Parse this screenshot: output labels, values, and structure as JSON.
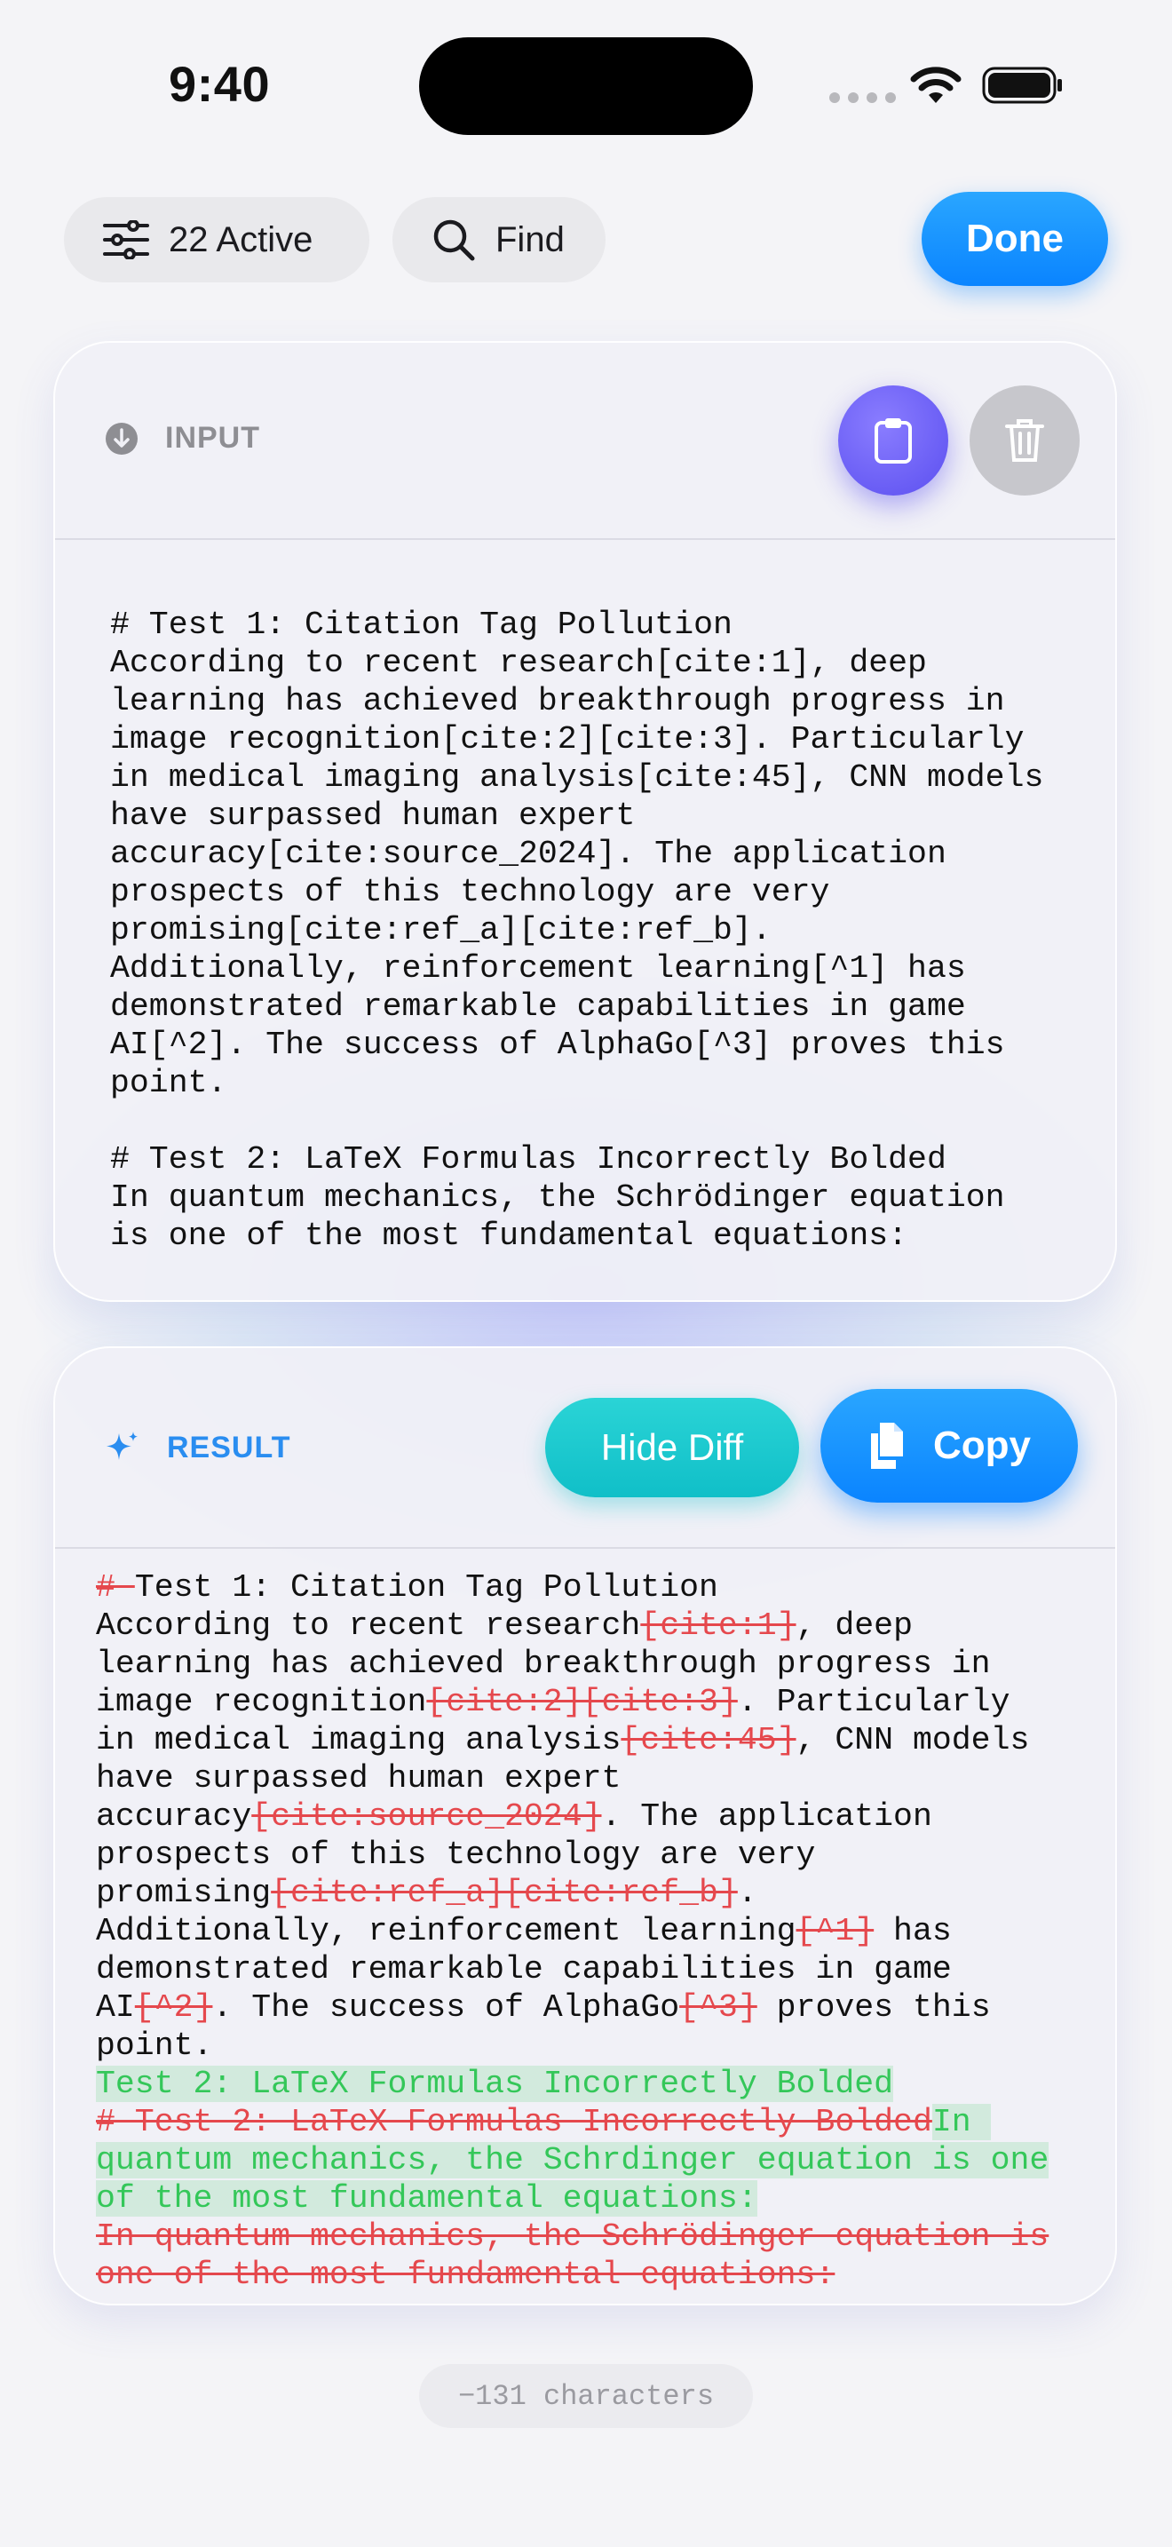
{
  "status_bar": {
    "time": "9:40"
  },
  "toolbar": {
    "filters_label": "22 Active",
    "find_label": "Find",
    "done_label": "Done"
  },
  "input_card": {
    "label": "INPUT",
    "lines": [
      "# Test 1: Citation Tag Pollution",
      "According to recent research[cite:1], deep",
      "learning has achieved breakthrough progress in",
      "image recognition[cite:2][cite:3]. Particularly",
      "in medical imaging analysis[cite:45], CNN models",
      "have surpassed human expert",
      "accuracy[cite:source_2024]. The application",
      "prospects of this technology are very",
      "promising[cite:ref_a][cite:ref_b].",
      "Additionally, reinforcement learning[^1] has",
      "demonstrated remarkable capabilities in game",
      "AI[^2]. The success of AlphaGo[^3] proves this",
      "point.",
      "",
      "# Test 2: LaTeX Formulas Incorrectly Bolded",
      "In quantum mechanics, the Schrödinger equation",
      "is one of the most fundamental equations:"
    ]
  },
  "result_card": {
    "label": "RESULT",
    "hide_diff_label": "Hide Diff",
    "copy_label": "Copy",
    "lines": [
      [
        {
          "t": "del",
          "v": "# "
        },
        {
          "t": "eq",
          "v": "Test 1: Citation Tag Pollution"
        }
      ],
      [
        {
          "t": "eq",
          "v": "According to recent research"
        },
        {
          "t": "del",
          "v": "[cite:1]"
        },
        {
          "t": "eq",
          "v": ", deep"
        }
      ],
      [
        {
          "t": "eq",
          "v": "learning has achieved breakthrough progress in"
        }
      ],
      [
        {
          "t": "eq",
          "v": "image recognition"
        },
        {
          "t": "del",
          "v": "[cite:2][cite:3]"
        },
        {
          "t": "eq",
          "v": ". Particularly"
        }
      ],
      [
        {
          "t": "eq",
          "v": "in medical imaging analysis"
        },
        {
          "t": "del",
          "v": "[cite:45]"
        },
        {
          "t": "eq",
          "v": ", CNN models"
        }
      ],
      [
        {
          "t": "eq",
          "v": "have surpassed human expert"
        }
      ],
      [
        {
          "t": "eq",
          "v": "accuracy"
        },
        {
          "t": "del",
          "v": "[cite:source_2024]"
        },
        {
          "t": "eq",
          "v": ". The application"
        }
      ],
      [
        {
          "t": "eq",
          "v": "prospects of this technology are very"
        }
      ],
      [
        {
          "t": "eq",
          "v": "promising"
        },
        {
          "t": "del",
          "v": "[cite:ref_a][cite:ref_b]"
        },
        {
          "t": "eq",
          "v": "."
        }
      ],
      [
        {
          "t": "eq",
          "v": "Additionally, reinforcement learning"
        },
        {
          "t": "del",
          "v": "[^1]"
        },
        {
          "t": "eq",
          "v": " has"
        }
      ],
      [
        {
          "t": "eq",
          "v": "demonstrated remarkable capabilities in game"
        }
      ],
      [
        {
          "t": "eq",
          "v": "AI"
        },
        {
          "t": "del",
          "v": "[^2]"
        },
        {
          "t": "eq",
          "v": ". The success of AlphaGo"
        },
        {
          "t": "del",
          "v": "[^3]"
        },
        {
          "t": "eq",
          "v": " proves this"
        }
      ],
      [
        {
          "t": "eq",
          "v": "point."
        }
      ],
      [
        {
          "t": "ins",
          "v": "Test 2: LaTeX Formulas Incorrectly Bolded"
        }
      ],
      [
        {
          "t": "del",
          "v": "# Test 2: LaTeX Formulas Incorrectly Bolded"
        },
        {
          "t": "ins",
          "v": "In "
        }
      ],
      [
        {
          "t": "ins",
          "v": "quantum mechanics, the Schrdinger equation is one"
        }
      ],
      [
        {
          "t": "ins",
          "v": "of the most fundamental equations:"
        }
      ],
      [
        {
          "t": "del",
          "v": "In quantum mechanics, the Schrödinger equation is"
        }
      ],
      [
        {
          "t": "del",
          "v": "one of the most fundamental equations:"
        }
      ]
    ]
  },
  "footer": {
    "char_delta": "−131 characters"
  },
  "colors": {
    "accent_blue": "#0a84ff",
    "paste_purple": "#5b4ff0",
    "diff_teal": "#10bfc8",
    "deleted_red": "#e5484d",
    "inserted_green": "#34c759"
  },
  "icons": [
    "sliders-icon",
    "search-icon",
    "arrow-down-circle-icon",
    "clipboard-icon",
    "trash-icon",
    "sparkle-icon",
    "documents-icon",
    "wifi-icon",
    "battery-icon"
  ]
}
